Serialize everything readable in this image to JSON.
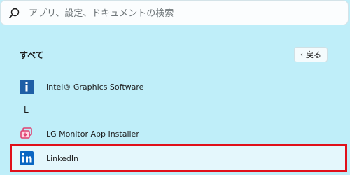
{
  "search": {
    "placeholder": "アプリ、設定、ドキュメントの検索",
    "icon": "search-icon"
  },
  "section": {
    "title": "すべて",
    "back_label": "戻る"
  },
  "apps": [
    {
      "label": "Intel® Graphics Software",
      "icon": "intel-graphics-icon"
    },
    {
      "label": "LG Monitor App Installer",
      "icon": "lg-installer-icon"
    },
    {
      "label": "LinkedIn",
      "icon": "linkedin-icon"
    }
  ],
  "letter_header": "L",
  "colors": {
    "background": "#bfeef9",
    "highlight_border": "#e0101a",
    "intel_blue": "#1f5fa6",
    "lg_pink": "#e04070",
    "linkedin_blue": "#0a66c2"
  }
}
